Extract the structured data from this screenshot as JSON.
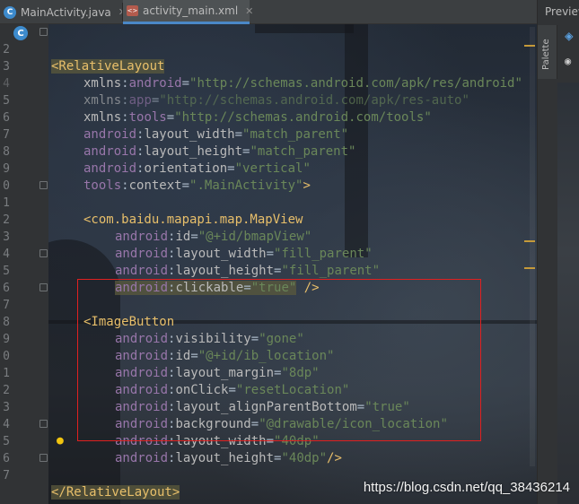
{
  "tabs": [
    {
      "label": "MainActivity.java",
      "icon": "java-class-icon"
    },
    {
      "label": "activity_main.xml",
      "icon": "xml-file-icon"
    }
  ],
  "preview_panel": {
    "title": "Preview",
    "palette_label": "Palette"
  },
  "gutter_badge": "C",
  "line_numbers": [
    "2",
    "3",
    "4",
    "5",
    "6",
    "7",
    "8",
    "9",
    "0",
    "1",
    "2",
    "3",
    "4",
    "5",
    "6",
    "7",
    "8",
    "9",
    "0",
    "1",
    "2",
    "3",
    "4",
    "5",
    "6",
    "7"
  ],
  "code": {
    "l1": {
      "tag": "<RelativeLayout"
    },
    "l2": {
      "ns": "xmlns",
      "colon": ":",
      "attr": "android",
      "eq": "=",
      "val": "\"http://schemas.android.com/apk/res/android\""
    },
    "l3": {
      "ns": "xmlns",
      "colon": ":",
      "attr": "app",
      "eq": "=",
      "val": "\"http://schemas.android.com/apk/res-auto\""
    },
    "l4": {
      "ns": "xmlns",
      "colon": ":",
      "attr": "tools",
      "eq": "=",
      "val": "\"http://schemas.android.com/tools\""
    },
    "l5": {
      "ns": "android",
      "colon": ":",
      "attr": "layout_width",
      "eq": "=",
      "val": "\"match_parent\""
    },
    "l6": {
      "ns": "android",
      "colon": ":",
      "attr": "layout_height",
      "eq": "=",
      "val": "\"match_parent\""
    },
    "l7": {
      "ns": "android",
      "colon": ":",
      "attr": "orientation",
      "eq": "=",
      "val": "\"vertical\""
    },
    "l8": {
      "ns": "tools",
      "colon": ":",
      "attr": "context",
      "eq": "=",
      "val": "\".MainActivity\"",
      "close": ">"
    },
    "l10": {
      "tag": "<com.baidu.mapapi.map.MapView"
    },
    "l11": {
      "ns": "android",
      "colon": ":",
      "attr": "id",
      "eq": "=",
      "val": "\"@+id/bmapView\""
    },
    "l12": {
      "ns": "android",
      "colon": ":",
      "attr": "layout_width",
      "eq": "=",
      "val": "\"fill_parent\""
    },
    "l13": {
      "ns": "android",
      "colon": ":",
      "attr": "layout_height",
      "eq": "=",
      "val": "\"fill_parent\""
    },
    "l14": {
      "ns": "android",
      "colon": ":",
      "attr": "clickable",
      "eq": "=",
      "val": "\"true\"",
      "close": " />"
    },
    "l16": {
      "tag": "<ImageButton"
    },
    "l17": {
      "ns": "android",
      "colon": ":",
      "attr": "visibility",
      "eq": "=",
      "val": "\"gone\""
    },
    "l18": {
      "ns": "android",
      "colon": ":",
      "attr": "id",
      "eq": "=",
      "val": "\"@+id/ib_location\""
    },
    "l19": {
      "ns": "android",
      "colon": ":",
      "attr": "layout_margin",
      "eq": "=",
      "val": "\"8dp\""
    },
    "l20": {
      "ns": "android",
      "colon": ":",
      "attr": "onClick",
      "eq": "=",
      "val": "\"resetLocation\""
    },
    "l21": {
      "ns": "android",
      "colon": ":",
      "attr": "layout_alignParentBottom",
      "eq": "=",
      "val": "\"true\""
    },
    "l22": {
      "ns": "android",
      "colon": ":",
      "attr": "background",
      "eq": "=",
      "val": "\"@drawable/icon_location\""
    },
    "l23": {
      "ns": "android",
      "colon": ":",
      "attr": "layout_width",
      "eq": "=",
      "val": "\"40dp\""
    },
    "l24": {
      "ns": "android",
      "colon": ":",
      "attr": "layout_height",
      "eq": "=",
      "val": "\"40dp\"",
      "close": "/>"
    },
    "l26": {
      "tag": "</RelativeLayout>"
    }
  },
  "watermark": "https://blog.csdn.net/qq_38436214",
  "colors": {
    "tag": "#e8bf6a",
    "namespace": "#9876aa",
    "attribute": "#bababa",
    "string": "#6a8759",
    "highlight_border": "#e02020"
  }
}
